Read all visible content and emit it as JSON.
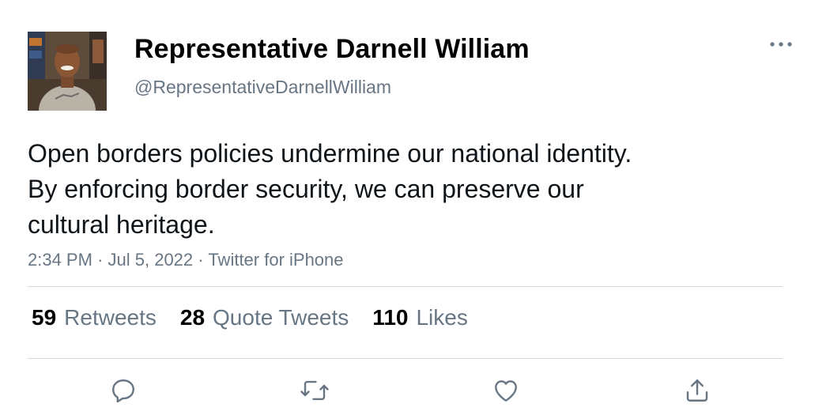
{
  "user": {
    "display_name": "Representative Darnell William",
    "handle": "@RepresentativeDarnellWilliam"
  },
  "tweet": {
    "lines": [
      "Open borders policies undermine our national identity.",
      "By enforcing border security, we can preserve our",
      "cultural heritage."
    ],
    "time": "2:34 PM",
    "date": "Jul 5, 2022",
    "source": "Twitter for iPhone",
    "separator": "·"
  },
  "stats": {
    "retweets": {
      "count": "59",
      "label": "Retweets"
    },
    "quotes": {
      "count": "28",
      "label": "Quote Tweets"
    },
    "likes": {
      "count": "110",
      "label": "Likes"
    }
  },
  "icons": {
    "more": "more-icon",
    "reply": "reply-icon",
    "retweet": "retweet-icon",
    "like": "like-icon",
    "share": "share-icon"
  },
  "colors": {
    "text": "#0f1419",
    "secondary": "#687684",
    "divider": "#cfd9de"
  }
}
